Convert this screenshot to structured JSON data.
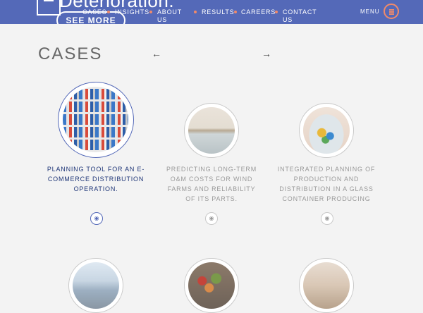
{
  "header": {
    "banner_text": "Deterioration.",
    "see_more": "SEE MORE",
    "nav": [
      "CASES",
      "INSIGHTS",
      "ABOUT US",
      "RESULTS",
      "CAREERS",
      "CONTACT US"
    ],
    "menu_label": "MENU"
  },
  "main": {
    "title": "CASES",
    "prev_arrow": "←",
    "next_arrow": "→",
    "cases": [
      {
        "title": "PLANNING TOOL FOR AN E-COMMERCE DISTRIBUTION OPERATION.",
        "image": "supermarket-shelves",
        "active": true
      },
      {
        "title": "PREDICTING LONG-TERM O&M COSTS FOR WIND FARMS AND RELIABILITY OF ITS PARTS.",
        "image": "coastline",
        "active": false
      },
      {
        "title": "INTEGRATED PLANNING OF PRODUCTION AND DISTRIBUTION IN A GLASS CONTAINER PRODUCING",
        "image": "glass-jar-candy",
        "active": false
      }
    ]
  },
  "colors": {
    "brand": "#5469b8",
    "accent": "#f08a6a",
    "active_text": "#1e3577",
    "muted_text": "#9a9a9a"
  }
}
